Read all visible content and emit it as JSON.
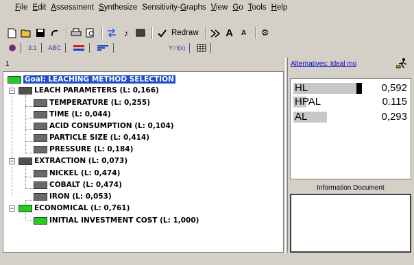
{
  "menu": [
    {
      "acc": "F",
      "rest": "ile"
    },
    {
      "acc": "E",
      "rest": "dit"
    },
    {
      "acc": "A",
      "rest": "ssessment"
    },
    {
      "acc": "S",
      "rest": "ynthesize"
    },
    {
      "pre": "Sensitivity-",
      "acc": "G",
      "rest": "raphs"
    },
    {
      "acc": "V",
      "rest": "iew"
    },
    {
      "acc": "G",
      "rest": "o"
    },
    {
      "acc": "T",
      "rest": "ools"
    },
    {
      "acc": "H",
      "rest": "elp"
    }
  ],
  "toolbar": {
    "redraw_label": "Redraw",
    "icons": [
      "new-file-icon",
      "open-folder-icon",
      "save-icon",
      "undo-icon",
      "print-icon",
      "print-preview-icon",
      "swap-icon",
      "music-note-icon",
      "stop-icon",
      "redraw-icon",
      "tree-arrow-icon",
      "font-large-icon",
      "font-small-icon",
      "settings-icon"
    ]
  },
  "tabs": {
    "ratio": "3:1",
    "abc": "ABC",
    "formula": "Y=f(x)"
  },
  "tree": {
    "header_number": "1",
    "goal": "Goal: LEACHING METHOD SELECTION",
    "nodes": [
      "LEACH PARAMETERS (L: 0,166)",
      "TEMPERATURE (L: 0,255)",
      "TIME (L: 0,044)",
      "ACID CONSUMPTION (L: 0,104)",
      "PARTICLE SIZE (L: 0,414)",
      "PRESSURE (L: 0,184)",
      "EXTRACTION (L: 0,073)",
      "NICKEL (L: 0,474)",
      "COBALT (L: 0,474)",
      "IRON (L: 0,053)",
      "ECONOMICAL (L: 0,761)",
      "INITIAL INVESTMENT COST (L: 1,000)"
    ]
  },
  "alternatives": {
    "header_link": "Alternatives: Ideal mo",
    "items": [
      {
        "name": "HL",
        "value": "0,592",
        "bar_fraction": 0.592
      },
      {
        "name": "HPAL",
        "value": "0.115",
        "bar_fraction": 0.115
      },
      {
        "name": "AL",
        "value": "0,293",
        "bar_fraction": 0.293
      }
    ]
  },
  "info": {
    "title": "Information Document"
  }
}
